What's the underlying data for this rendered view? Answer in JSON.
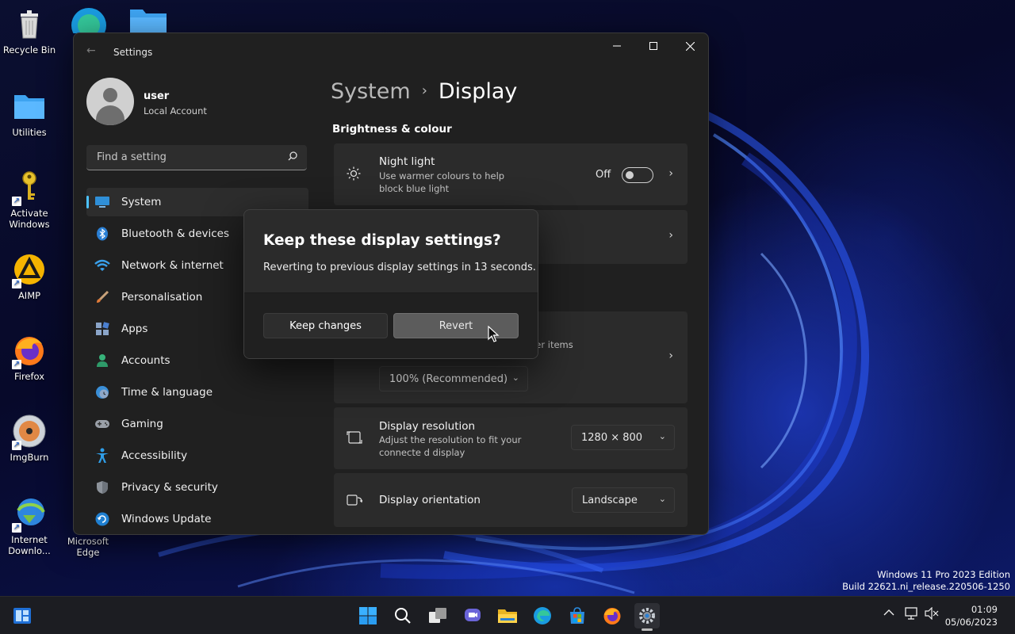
{
  "desktop": {
    "icons": [
      {
        "label": "Recycle Bin",
        "icon": "recycle-bin-icon"
      },
      {
        "label": "Utilities",
        "icon": "folder-icon"
      },
      {
        "label": "Activate Windows",
        "icon": "key-icon"
      },
      {
        "label": "AIMP",
        "icon": "aimp-icon"
      },
      {
        "label": "Firefox",
        "icon": "firefox-icon"
      },
      {
        "label": "ImgBurn",
        "icon": "imgburn-icon"
      },
      {
        "label": "Internet Downlo...",
        "icon": "idm-icon"
      },
      {
        "label": "Microsoft Edge",
        "icon": "edge-icon"
      }
    ],
    "watermark": {
      "line1": "Windows 11 Pro 2023 Edition",
      "line2": "Build 22621.ni_release.220506-1250"
    }
  },
  "window": {
    "title": "Settings",
    "profile": {
      "name": "user",
      "type": "Local Account"
    },
    "search": {
      "placeholder": "Find a setting"
    },
    "nav": [
      {
        "label": "System",
        "icon": "system-display-icon",
        "active": true
      },
      {
        "label": "Bluetooth & devices",
        "icon": "bluetooth-icon"
      },
      {
        "label": "Network & internet",
        "icon": "wifi-icon"
      },
      {
        "label": "Personalisation",
        "icon": "brush-icon"
      },
      {
        "label": "Apps",
        "icon": "apps-icon"
      },
      {
        "label": "Accounts",
        "icon": "person-icon"
      },
      {
        "label": "Time & language",
        "icon": "globe-clock-icon"
      },
      {
        "label": "Gaming",
        "icon": "gamepad-icon"
      },
      {
        "label": "Accessibility",
        "icon": "accessibility-icon"
      },
      {
        "label": "Privacy & security",
        "icon": "shield-icon"
      },
      {
        "label": "Windows Update",
        "icon": "update-icon"
      }
    ],
    "breadcrumb": {
      "parent": "System",
      "separator": "›",
      "current": "Display"
    },
    "section_heading": "Brightness & colour",
    "night_light": {
      "title": "Night light",
      "subtitle": "Use warmer colours to help block blue light",
      "state": "Off"
    },
    "scale": {
      "subtitle_fragment": "her items",
      "value": "100% (Recommended)"
    },
    "resolution": {
      "title": "Display resolution",
      "subtitle": "Adjust the resolution to fit your connecte d display",
      "value": "1280 × 800"
    },
    "orientation": {
      "title": "Display orientation",
      "value": "Landscape"
    }
  },
  "dialog": {
    "title": "Keep these display settings?",
    "message": "Reverting to previous display settings in 13 seconds.",
    "keep_label": "Keep changes",
    "revert_label": "Revert"
  },
  "taskbar": {
    "apps": [
      "start-icon",
      "search-icon",
      "task-view-icon",
      "chat-icon",
      "file-explorer-icon",
      "edge-icon",
      "store-icon",
      "firefox-icon",
      "settings-icon"
    ],
    "clock": {
      "time": "01:09",
      "date": "05/06/2023"
    }
  },
  "colors": {
    "accent": "#4cc2ff",
    "window_bg": "#202020",
    "card_bg": "#2b2b2b"
  }
}
